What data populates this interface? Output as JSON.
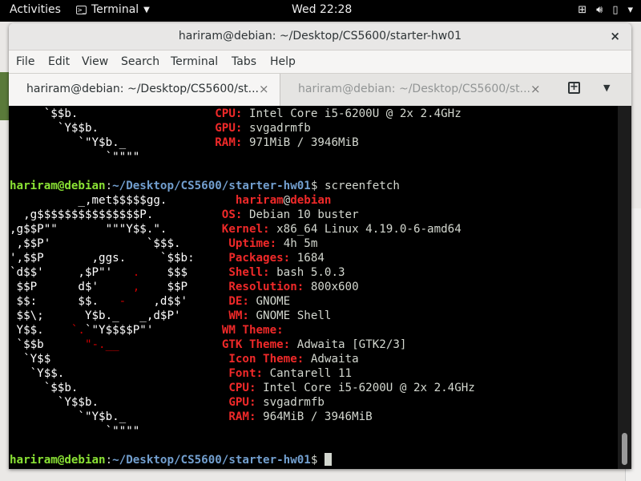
{
  "topbar": {
    "activities": "Activities",
    "app_name": "Terminal",
    "clock": "Wed 22:28"
  },
  "window": {
    "title": "hariram@debian: ~/Desktop/CS5600/starter-hw01",
    "close": "×"
  },
  "menu": [
    "File",
    "Edit",
    "View",
    "Search",
    "Terminal",
    "Tabs",
    "Help"
  ],
  "tabs": [
    {
      "label": "hariram@debian: ~/Desktop/CS5600/st...",
      "close": "×",
      "active": true
    },
    {
      "label": "hariram@debian: ~/Desktop/CS5600/st...",
      "close": "×",
      "active": false
    }
  ],
  "terminal": {
    "prompt_user": "hariram@debian",
    "prompt_sep": ":",
    "prompt_path": "~/Desktop/CS5600/starter-hw01",
    "prompt_end": "$",
    "command": " screenfetch",
    "top": [
      {
        "art": "     `$$b.                    ",
        "key": "CPU: ",
        "val": "Intel Core i5-6200U @ 2x 2.4GHz"
      },
      {
        "art": "       `Y$$b.                 ",
        "key": "GPU: ",
        "val": "svgadrmfb"
      },
      {
        "art": "          `\"Y$b._             ",
        "key": "RAM: ",
        "val": "971MiB / 3946MiB"
      },
      {
        "art": "              `\"\"\"\"",
        "key": "",
        "val": ""
      }
    ],
    "fetch": {
      "user": "hariram",
      "at": "@",
      "host": "debian",
      "lines": [
        {
          "art": "  ,g$$$$$$$$$$$$$$$P.          ",
          "key": "OS: ",
          "val": "Debian 10 buster"
        },
        {
          "art": ",g$$P\"\"       \"\"\"Y$$.\".        ",
          "key": "Kernel: ",
          "val": "x86_64 Linux 4.19.0-6-amd64"
        },
        {
          "art": " ,$$P'              `$$$.       ",
          "key": "Uptime: ",
          "val": "4h 5m"
        },
        {
          "art": "',$$P       ,ggs.     `$$b:     ",
          "key": "Packages: ",
          "val": "1684"
        },
        {
          "art": "`d$$'     ,$P\"'   ",
          "art_red": ".",
          "art_after": "    $$$      ",
          "key": "Shell: ",
          "val": "bash 5.0.3"
        },
        {
          "art": " $$P      d$'     ",
          "art_red": ",",
          "art_after": "    $$P      ",
          "key": "Resolution: ",
          "val": "800x600"
        },
        {
          "art": " $$:      $$.   ",
          "art_red": "-",
          "art_after": "    ,d$$'      ",
          "key": "DE: ",
          "val": "GNOME"
        },
        {
          "art": " $$\\;      Y$b._   _,d$P'       ",
          "key": "WM: ",
          "val": "GNOME Shell"
        },
        {
          "art": " Y$$.    ",
          "art_red": "`.",
          "art_after": "`\"Y$$$$P\"'          ",
          "key": "WM Theme: ",
          "val": ""
        },
        {
          "art": " `$$b      ",
          "art_red": "\"-.__",
          "art_after": "               ",
          "key": "GTK Theme: ",
          "val": "Adwaita [GTK2/3]"
        },
        {
          "art": "  `Y$$                          ",
          "key": "Icon Theme: ",
          "val": "Adwaita"
        },
        {
          "art": "   `Y$$.                        ",
          "key": "Font: ",
          "val": "Cantarell 11"
        },
        {
          "art": "     `$$b.                      ",
          "key": "CPU: ",
          "val": "Intel Core i5-6200U @ 2x 2.4GHz"
        },
        {
          "art": "       `Y$$b.                   ",
          "key": "GPU: ",
          "val": "svgadrmfb"
        },
        {
          "art": "          `\"Y$b._               ",
          "key": "RAM: ",
          "val": "964MiB / 3946MiB"
        },
        {
          "art": "              `\"\"\"\"",
          "key": "",
          "val": ""
        }
      ],
      "first_art": "          _,met$$$$$gg.          "
    }
  }
}
